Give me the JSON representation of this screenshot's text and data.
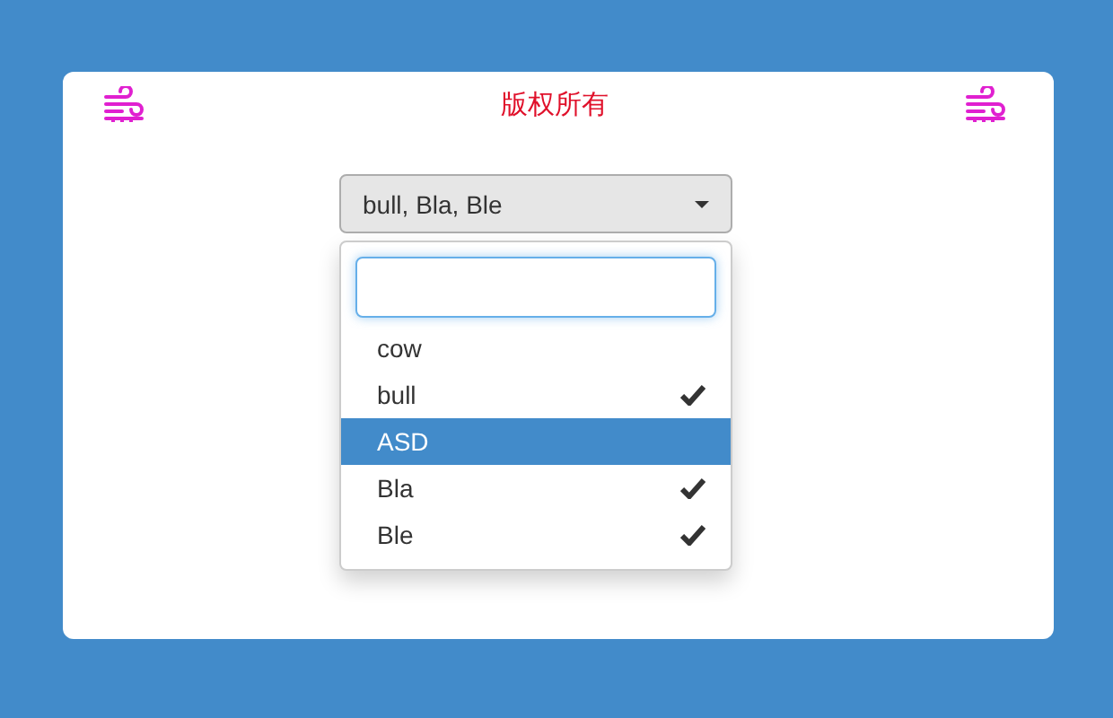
{
  "header": {
    "title": "版权所有"
  },
  "select": {
    "value": "bull, Bla, Ble"
  },
  "dropdown": {
    "options": [
      {
        "label": "cow",
        "checked": false,
        "active": false
      },
      {
        "label": "bull",
        "checked": true,
        "active": false
      },
      {
        "label": "ASD",
        "checked": false,
        "active": true
      },
      {
        "label": "Bla",
        "checked": true,
        "active": false
      },
      {
        "label": "Ble",
        "checked": true,
        "active": false
      }
    ]
  }
}
